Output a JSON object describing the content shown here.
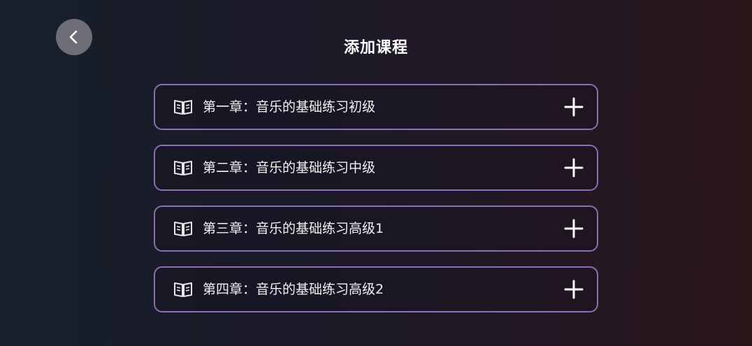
{
  "header": {
    "back_icon": "chevron-left-icon",
    "title": "添加课程"
  },
  "courses": [
    {
      "label": "第一章：音乐的基础练习初级",
      "icon": "book-icon",
      "action_icon": "plus-icon"
    },
    {
      "label": "第二章：音乐的基础练习中级",
      "icon": "book-icon",
      "action_icon": "plus-icon"
    },
    {
      "label": "第三章：音乐的基础练习高级1",
      "icon": "book-icon",
      "action_icon": "plus-icon"
    },
    {
      "label": "第四章：音乐的基础练习高级2",
      "icon": "book-icon",
      "action_icon": "plus-icon"
    }
  ],
  "colors": {
    "card_border": "#8a6fb2",
    "back_button_bg": "#6d6e76",
    "text": "#ffffff"
  }
}
